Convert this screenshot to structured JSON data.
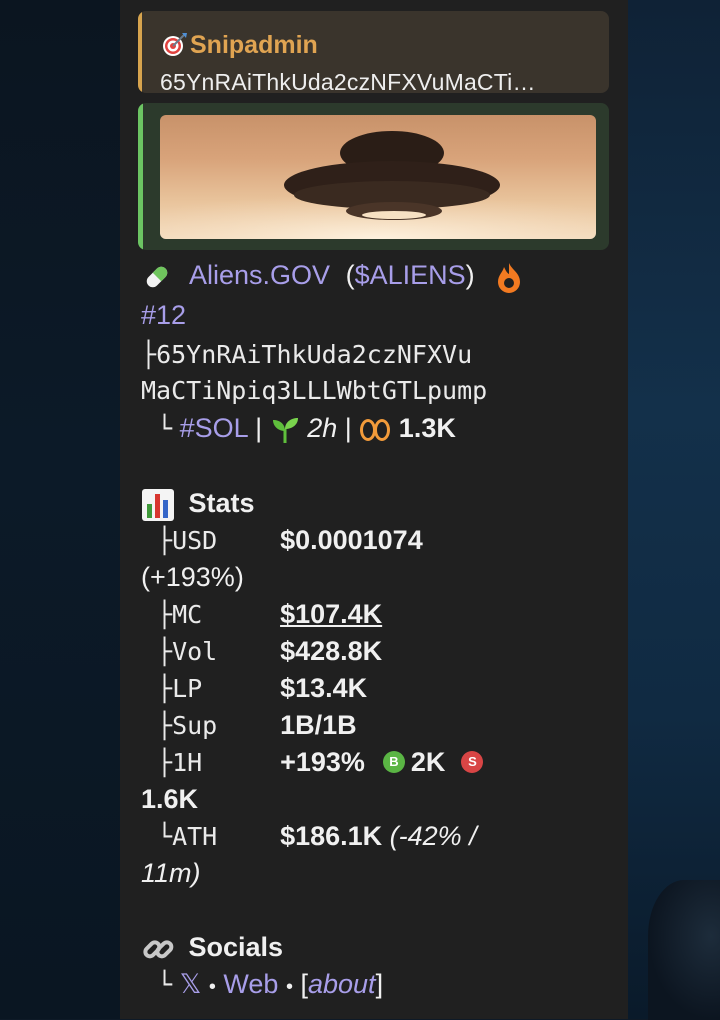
{
  "reply": {
    "sender": "Snipadmin",
    "text": "65YnRAiThkUda2czNFXVuMaCTi…"
  },
  "token": {
    "name": "Aliens.GOV",
    "ticker_open": "(",
    "ticker": "$ALIENS",
    "ticker_close": ")",
    "rank": "#12",
    "address_prefix": "├",
    "address_line1": "65YnRAiThkUda2czNFXVu",
    "address_line2": "MaCTiNpiq3LLLWbtGTLpump",
    "chain_prefix": "└",
    "chain": "#SOL",
    "sep1": "|",
    "age": "2h",
    "sep2": "|",
    "views": "1.3K"
  },
  "stats": {
    "title": "Stats",
    "tree_mid": "├",
    "tree_end": "└",
    "usd_label": "USD",
    "usd_value": "$0.0001074",
    "usd_change": "(+193%)",
    "mc_label": "MC",
    "mc_value": "$107.4K",
    "vol_label": "Vol",
    "vol_value": "$428.8K",
    "lp_label": "LP",
    "lp_value": "$13.4K",
    "sup_label": "Sup",
    "sup_value": "1B/1B",
    "h1_label": "1H",
    "h1_change": "+193%",
    "buy_badge": "B",
    "buys": "2K",
    "sell_badge": "S",
    "sells": "1.6K",
    "ath_label": "ATH",
    "ath_value": "$186.1K",
    "ath_detail_1": "(-42% /",
    "ath_detail_2": "11m)"
  },
  "socials": {
    "title": "Socials",
    "tree_end": "└",
    "x": "𝕏",
    "dot1": "•",
    "web": "Web",
    "dot2": "•",
    "about_open": "[",
    "about": "about",
    "about_close": "]"
  },
  "colors": {
    "link": "#a89ee9",
    "reply_accent": "#d7a44e",
    "media_accent": "#6cc463",
    "bubble_bg": "#202020"
  }
}
